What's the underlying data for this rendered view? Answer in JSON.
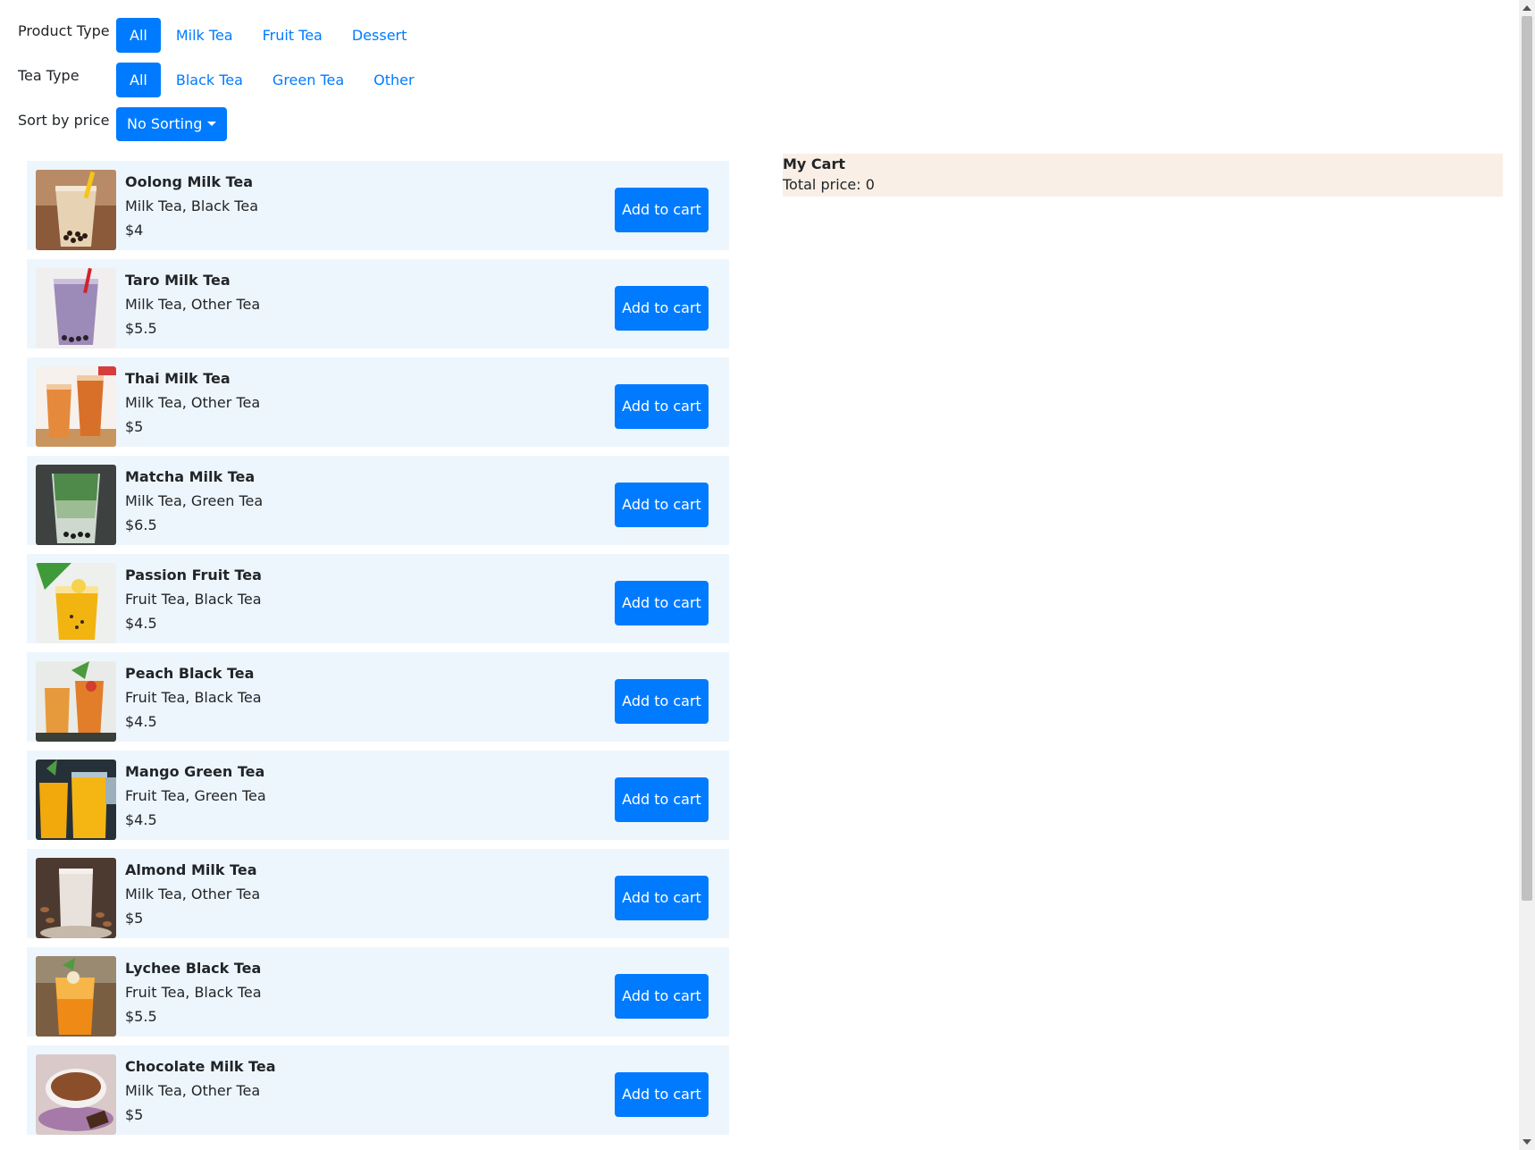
{
  "filters": {
    "product_type": {
      "label": "Product Type",
      "options": [
        "All",
        "Milk Tea",
        "Fruit Tea",
        "Dessert"
      ],
      "selected": "All"
    },
    "tea_type": {
      "label": "Tea Type",
      "options": [
        "All",
        "Black Tea",
        "Green Tea",
        "Other"
      ],
      "selected": "All"
    },
    "sort": {
      "label": "Sort by price",
      "value": "No Sorting"
    }
  },
  "products": [
    {
      "name": "Oolong Milk Tea",
      "tags": "Milk Tea, Black Tea",
      "price": "$4",
      "button": "Add to cart",
      "image": "milk-tea-with-boba"
    },
    {
      "name": "Taro Milk Tea",
      "tags": "Milk Tea, Other Tea",
      "price": "$5.5",
      "button": "Add to cart",
      "image": "purple-taro-drink"
    },
    {
      "name": "Thai Milk Tea",
      "tags": "Milk Tea, Other Tea",
      "price": "$5",
      "button": "Add to cart",
      "image": "orange-thai-tea"
    },
    {
      "name": "Matcha Milk Tea",
      "tags": "Milk Tea, Green Tea",
      "price": "$6.5",
      "button": "Add to cart",
      "image": "green-matcha-drink"
    },
    {
      "name": "Passion Fruit Tea",
      "tags": "Fruit Tea, Black Tea",
      "price": "$4.5",
      "button": "Add to cart",
      "image": "yellow-passion-fruit-tea"
    },
    {
      "name": "Peach Black Tea",
      "tags": "Fruit Tea, Black Tea",
      "price": "$4.5",
      "button": "Add to cart",
      "image": "peach-iced-tea"
    },
    {
      "name": "Mango Green Tea",
      "tags": "Fruit Tea, Green Tea",
      "price": "$4.5",
      "button": "Add to cart",
      "image": "mango-drink-jars"
    },
    {
      "name": "Almond Milk Tea",
      "tags": "Milk Tea, Other Tea",
      "price": "$5",
      "button": "Add to cart",
      "image": "almond-milk-drink"
    },
    {
      "name": "Lychee Black Tea",
      "tags": "Fruit Tea, Black Tea",
      "price": "$5.5",
      "button": "Add to cart",
      "image": "lychee-iced-tea"
    },
    {
      "name": "Chocolate Milk Tea",
      "tags": "Milk Tea, Other Tea",
      "price": "$5",
      "button": "Add to cart",
      "image": "chocolate-drink-cup"
    }
  ],
  "cart": {
    "title": "My Cart",
    "total_label": "Total price: 0"
  },
  "colors": {
    "primary": "#007bff",
    "card_bg": "#eef6fd",
    "cart_bg": "#f9efe6"
  }
}
